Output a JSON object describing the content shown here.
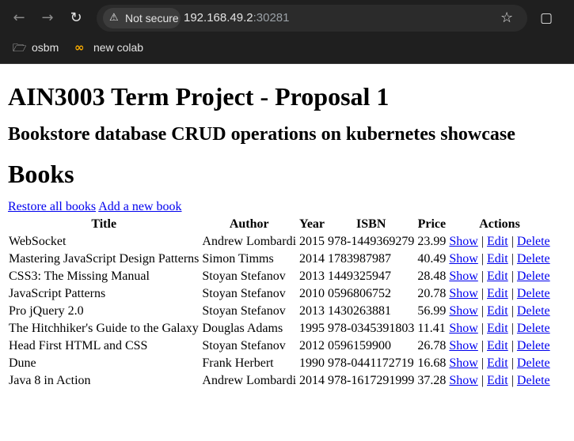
{
  "browser": {
    "security_label": "Not secure",
    "url_host": "192.168.49.2",
    "url_port": ":30281",
    "bookmarks": [
      {
        "label": "osbm"
      },
      {
        "label": "new colab"
      }
    ]
  },
  "page": {
    "title": "AIN3003 Term Project - Proposal 1",
    "subtitle": "Bookstore database CRUD operations on kubernetes showcase",
    "section_title": "Books",
    "restore_link": "Restore all books",
    "add_link": "Add a new book",
    "columns": [
      "Title",
      "Author",
      "Year",
      "ISBN",
      "Price",
      "Actions"
    ],
    "action_labels": {
      "show": "Show",
      "edit": "Edit",
      "delete": "Delete",
      "sep": "|"
    },
    "books": [
      {
        "title": "WebSocket",
        "author": "Andrew Lombardi",
        "year": "2015",
        "isbn": "978-1449369279",
        "price": "23.99"
      },
      {
        "title": "Mastering JavaScript Design Patterns",
        "author": "Simon Timms",
        "year": "2014",
        "isbn": "1783987987",
        "price": "40.49"
      },
      {
        "title": "CSS3: The Missing Manual",
        "author": "Stoyan Stefanov",
        "year": "2013",
        "isbn": "1449325947",
        "price": "28.48"
      },
      {
        "title": "JavaScript Patterns",
        "author": "Stoyan Stefanov",
        "year": "2010",
        "isbn": "0596806752",
        "price": "20.78"
      },
      {
        "title": "Pro jQuery 2.0",
        "author": "Stoyan Stefanov",
        "year": "2013",
        "isbn": "1430263881",
        "price": "56.99"
      },
      {
        "title": "The Hitchhiker's Guide to the Galaxy",
        "author": "Douglas Adams",
        "year": "1995",
        "isbn": "978-0345391803",
        "price": "11.41"
      },
      {
        "title": "Head First HTML and CSS",
        "author": "Stoyan Stefanov",
        "year": "2012",
        "isbn": "0596159900",
        "price": "26.78"
      },
      {
        "title": "Dune",
        "author": "Frank Herbert",
        "year": "1990",
        "isbn": "978-0441172719",
        "price": "16.68"
      },
      {
        "title": "Java 8 in Action",
        "author": "Andrew Lombardi",
        "year": "2014",
        "isbn": "978-1617291999",
        "price": "37.28"
      }
    ]
  }
}
